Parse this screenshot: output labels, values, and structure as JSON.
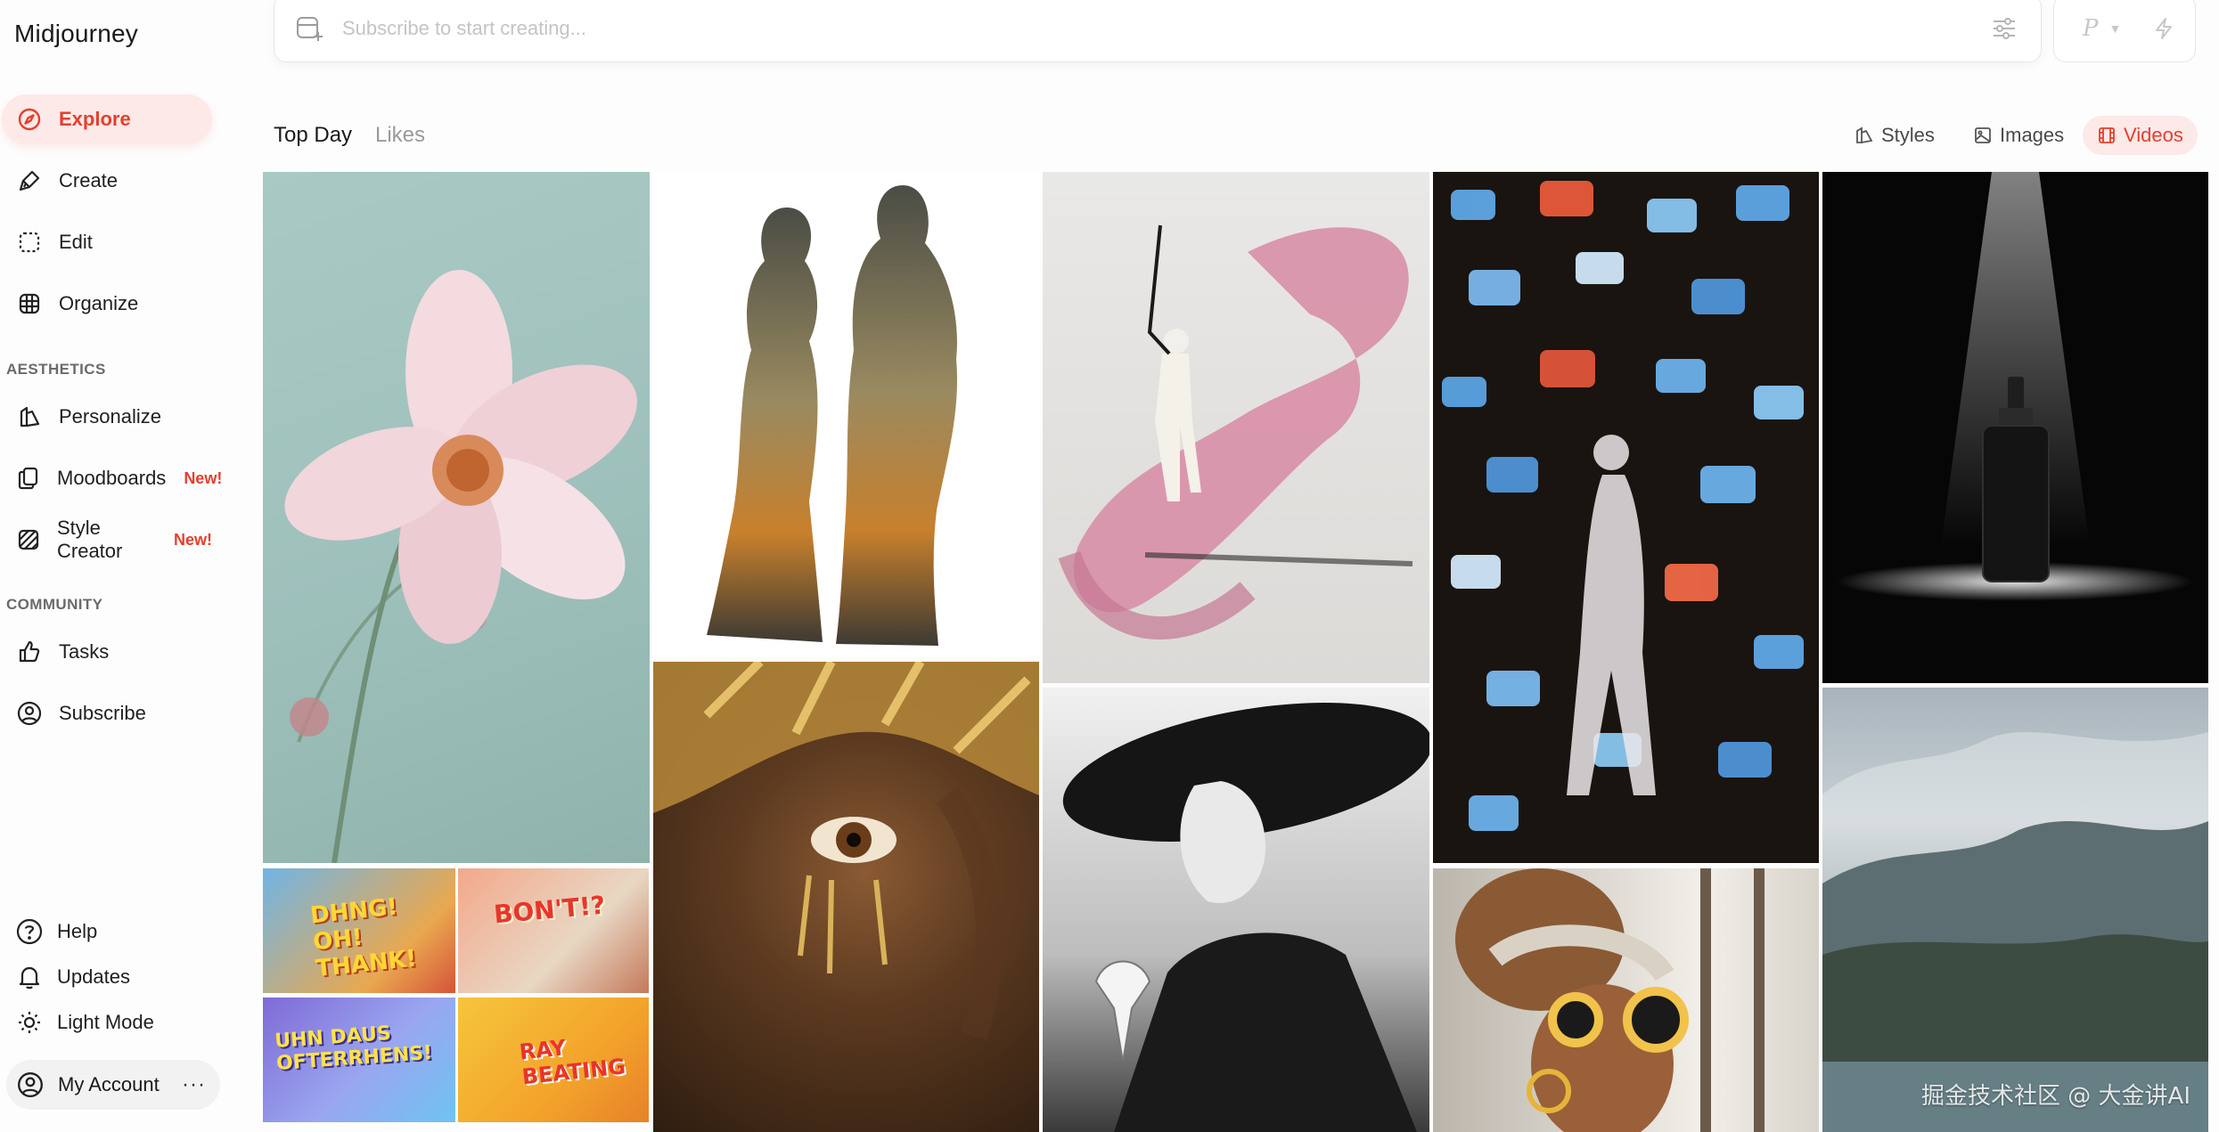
{
  "app": {
    "logo": "Midjourney"
  },
  "sidebar": {
    "main": [
      {
        "label": "Explore",
        "icon": "compass-icon",
        "active": true
      },
      {
        "label": "Create",
        "icon": "brush-icon"
      },
      {
        "label": "Edit",
        "icon": "edit-icon"
      },
      {
        "label": "Organize",
        "icon": "grid-icon"
      }
    ],
    "aesthetics_label": "AESTHETICS",
    "aesthetics": [
      {
        "label": "Personalize",
        "icon": "personalize-icon"
      },
      {
        "label": "Moodboards",
        "icon": "moodboard-icon",
        "badge": "New!"
      },
      {
        "label": "Style Creator",
        "icon": "style-creator-icon",
        "badge": "New!"
      }
    ],
    "community_label": "COMMUNITY",
    "community": [
      {
        "label": "Tasks",
        "icon": "thumbs-up-icon"
      },
      {
        "label": "Subscribe",
        "icon": "user-circle-icon"
      }
    ],
    "bottom": [
      {
        "label": "Help",
        "icon": "help-icon"
      },
      {
        "label": "Updates",
        "icon": "bell-icon"
      },
      {
        "label": "Light Mode",
        "icon": "sun-icon"
      }
    ],
    "account": {
      "label": "My Account",
      "more": "···"
    }
  },
  "prompt": {
    "placeholder": "Subscribe to start creating...",
    "mode_letter": "P"
  },
  "tabs": [
    {
      "label": "Top Day",
      "active": true
    },
    {
      "label": "Likes",
      "active": false
    }
  ],
  "filters": [
    {
      "label": "Styles",
      "active": false
    },
    {
      "label": "Images",
      "active": false
    },
    {
      "label": "Videos",
      "active": true
    }
  ],
  "thumbs": {
    "a": "DHNG! OH! THANK!",
    "b": "BON'T!?",
    "c": "UHN DAUS OFTERRHENS!",
    "d": "RAY BEATING"
  },
  "watermark": "掘金技术社区 @ 大金讲AI",
  "colors": {
    "accent": "#e3402d",
    "accent_bg": "#fde9e7"
  }
}
